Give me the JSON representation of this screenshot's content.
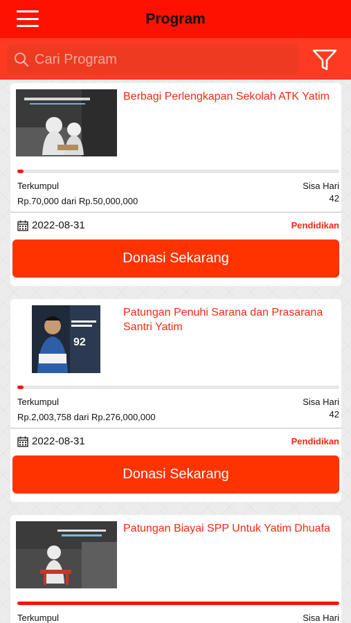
{
  "header": {
    "title": "Program"
  },
  "search": {
    "placeholder": "Cari Program"
  },
  "colors": {
    "brand": "#ff1100",
    "accent_text": "#f02a10",
    "button": "#ff3300"
  },
  "programs": [
    {
      "title": "Berbagi Perlengkapan Sekolah ATK Yatim",
      "progress_fraction": 0.02,
      "collected_label": "Terkumpul",
      "amount": "Rp.70,000 dari Rp.50,000,000",
      "days_label": "Sisa Hari",
      "days": "42",
      "date": "2022-08-31",
      "category": "Pendidikan",
      "button": "Donasi Sekarang",
      "thumb_text": "Menjadi Yatim Bukanlah Sebuah pilihan"
    },
    {
      "title": "Patungan Penuhi Sarana dan Prasarana Santri Yatim",
      "progress_fraction": 0.02,
      "collected_label": "Terkumpul",
      "amount": "Rp.2,003,758 dari Rp.276,000,000",
      "days_label": "Sisa Hari",
      "days": "42",
      "date": "2022-08-31",
      "category": "Pendidikan",
      "button": "Donasi Sekarang",
      "thumb_text": "Bantu Kebutuhan Ranjang & Kasur",
      "thumb_number": "92"
    },
    {
      "title": "Patungan Biayai SPP Untuk Yatim Dhuafa",
      "progress_fraction": 1.0,
      "collected_label": "Terkumpul",
      "days_label": "Sisa Hari",
      "thumb_text": "Cicil bukan sekadar"
    }
  ]
}
